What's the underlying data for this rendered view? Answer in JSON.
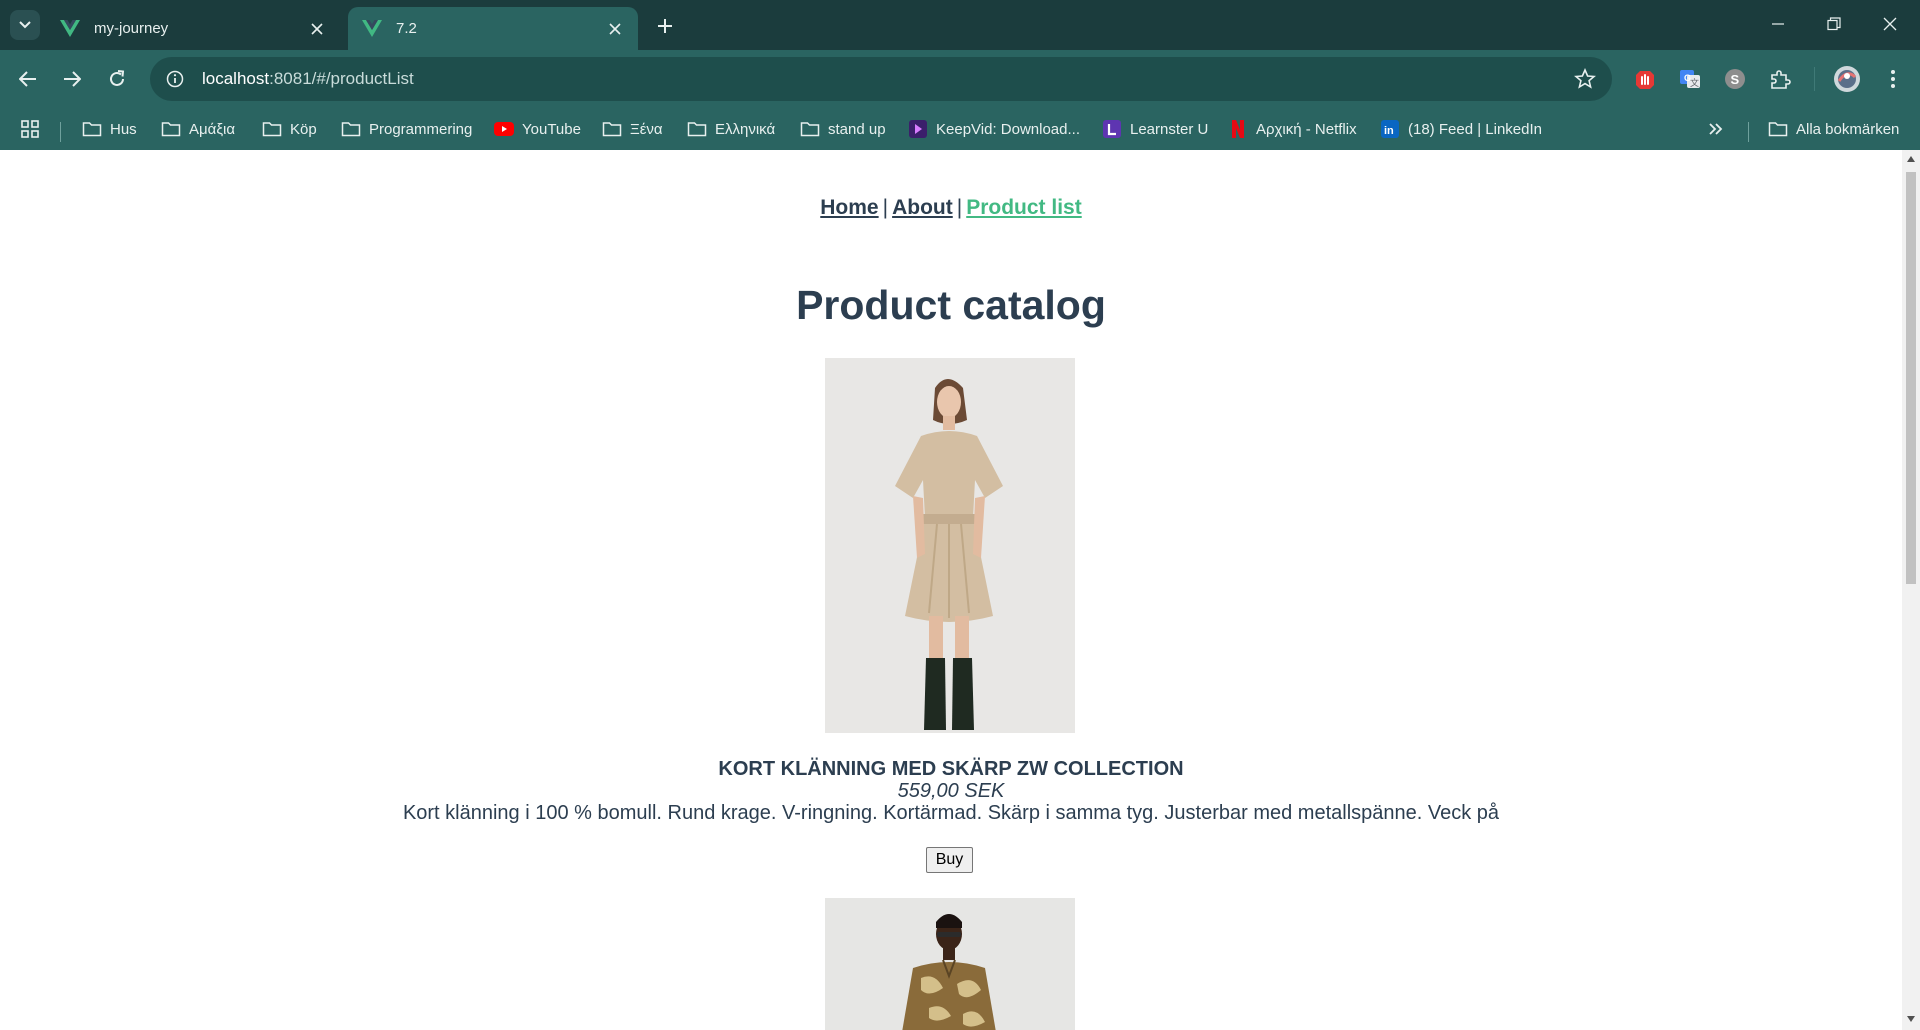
{
  "browser": {
    "tabs": [
      {
        "title": "my-journey",
        "active": false
      },
      {
        "title": "7.2",
        "active": true
      }
    ],
    "address": {
      "host": "localhost",
      "rest": ":8081/#/productList"
    },
    "bookmarks": [
      {
        "label": "Hus",
        "icon": "folder-icon"
      },
      {
        "label": "Αμάξια",
        "icon": "folder-icon"
      },
      {
        "label": "Köp",
        "icon": "folder-icon"
      },
      {
        "label": "Programmering",
        "icon": "folder-icon"
      },
      {
        "label": "YouTube",
        "icon": "youtube-icon"
      },
      {
        "label": "Ξένα",
        "icon": "folder-icon"
      },
      {
        "label": "Ελληνικά",
        "icon": "folder-icon"
      },
      {
        "label": "stand up",
        "icon": "folder-icon"
      },
      {
        "label": "KeepVid: Download...",
        "icon": "keepvid-icon"
      },
      {
        "label": "Learnster U",
        "icon": "learnster-icon"
      },
      {
        "label": "Αρχική - Netflix",
        "icon": "netflix-icon"
      },
      {
        "label": "(18) Feed | LinkedIn",
        "icon": "linkedin-icon"
      }
    ],
    "all_bookmarks_label": "Alla bokmärken",
    "colors": {
      "frame": "#1b3c3d",
      "toolbar": "#2a6461",
      "omnibox": "#1e4e4c"
    }
  },
  "site": {
    "nav": {
      "home": "Home",
      "about": "About",
      "product_list": "Product list",
      "separator": "|"
    },
    "title": "Product catalog",
    "products": [
      {
        "name": "KORT KLÄNNING MED SKÄRP ZW COLLECTION",
        "price": "559,00 SEK",
        "description": "Kort klänning i 100 % bomull. Rund krage. V-ringning. Kortärmad. Skärp i samma tyg. Justerbar med metallspänne. Veck på",
        "button": "Buy"
      }
    ],
    "colors": {
      "text": "#2c3e50",
      "active_link": "#42b983"
    }
  }
}
